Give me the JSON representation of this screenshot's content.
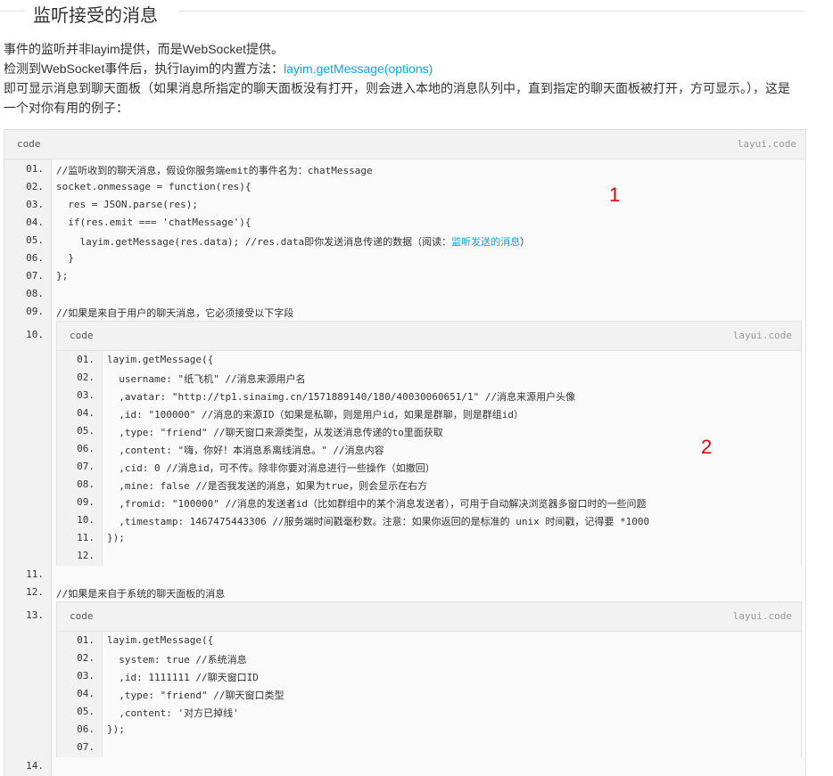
{
  "section": {
    "title": "监听接受的消息"
  },
  "intro": {
    "line1": "事件的监听并非layim提供，而是WebSocket提供。",
    "line2_text": "检测到WebSocket事件后，执行layim的内置方法：",
    "line2_link": "layim.getMessage(options)",
    "line3": "即可显示消息到聊天面板（如果消息所指定的聊天面板没有打开，则会进入本地的消息队列中，直到指定的聊天面板被打开，方可显示。），这是",
    "line4": "一个对你有用的例子："
  },
  "outer_block": {
    "label": "code",
    "brand": "layui.code",
    "line_numbers": [
      "01.",
      "02.",
      "03.",
      "04.",
      "05.",
      "06.",
      "07.",
      "08.",
      "09.",
      "10.",
      "11.",
      "12.",
      "13.",
      "14."
    ],
    "lines": {
      "l01": "//监听收到的聊天消息，假设你服务端emit的事件名为：chatMessage",
      "l02": "socket.onmessage = function(res){",
      "l03": "  res = JSON.parse(res);",
      "l04": "  if(res.emit === 'chatMessage'){",
      "l05_pre": "    layim.getMessage(res.data); //res.data即你发送消息传递的数据（阅读：",
      "l05_link": "监听发送的消息",
      "l05_post": "）",
      "l06": "  }",
      "l07": "};",
      "l08": "",
      "l09": "//如果是来自于用户的聊天消息，它必须接受以下字段",
      "l11": "",
      "l12": "//如果是来自于系统的聊天面板的消息",
      "l14": ""
    }
  },
  "inner_block_1": {
    "label": "code",
    "brand": "layui.code",
    "line_numbers": [
      "01.",
      "02.",
      "03.",
      "04.",
      "05.",
      "06.",
      "07.",
      "08.",
      "09.",
      "10.",
      "11.",
      "12."
    ],
    "lines": [
      "layim.getMessage({",
      "  username: \"纸飞机\" //消息来源用户名",
      "  ,avatar: \"http://tp1.sinaimg.cn/1571889140/180/40030060651/1\" //消息来源用户头像",
      "  ,id: \"100000\" //消息的来源ID（如果是私聊，则是用户id，如果是群聊，则是群组id）",
      "  ,type: \"friend\" //聊天窗口来源类型，从发送消息传递的to里面获取",
      "  ,content: \"嗨，你好！本消息系离线消息。\" //消息内容",
      "  ,cid: 0 //消息id，可不传。除非你要对消息进行一些操作（如撤回）",
      "  ,mine: false //是否我发送的消息，如果为true，则会显示在右方",
      "  ,fromid: \"100000\" //消息的发送者id（比如群组中的某个消息发送者），可用于自动解决浏览器多窗口时的一些问题",
      "  ,timestamp: 1467475443306 //服务端时间戳毫秒数。注意：如果你返回的是标准的 unix 时间戳，记得要 *1000",
      "});",
      ""
    ]
  },
  "inner_block_2": {
    "label": "code",
    "brand": "layui.code",
    "line_numbers": [
      "01.",
      "02.",
      "03.",
      "04.",
      "05.",
      "06.",
      "07."
    ],
    "lines": [
      "layim.getMessage({",
      "  system: true //系统消息",
      "  ,id: 1111111 //聊天窗口ID",
      "  ,type: \"friend\" //聊天窗口类型",
      "  ,content: '对方已掉线'",
      "});",
      ""
    ]
  },
  "annotations": {
    "a1": "1",
    "a2": "2"
  },
  "colors": {
    "link": "#01aaed",
    "annotation": "#e60000",
    "border": "#e2e2e2",
    "header_bg": "#f2f2f2",
    "code_bg": "#fafafa"
  }
}
